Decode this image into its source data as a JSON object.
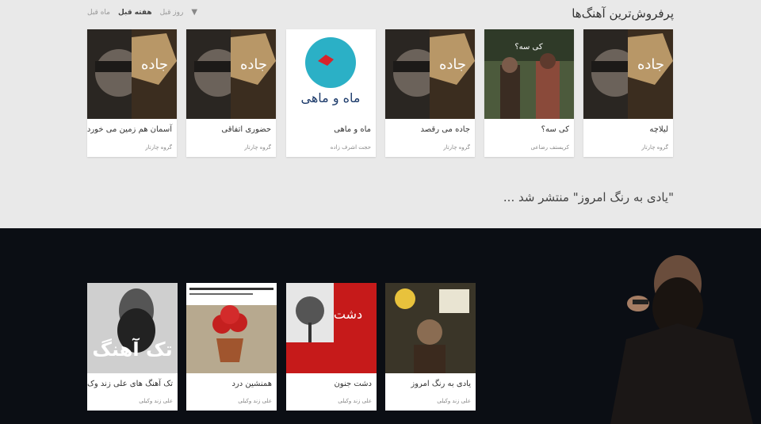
{
  "bestsellers": {
    "title": "پرفروش‌ترین آهنگ‌ها",
    "filters": [
      "روز قبل",
      "هفته قبل",
      "ماه قبل"
    ],
    "active_filter": "هفته قبل",
    "items": [
      {
        "title": "لیلاچه",
        "artist": "گروه چارتار"
      },
      {
        "title": "کی سه؟",
        "artist": "کریستف رضاعی"
      },
      {
        "title": "جاده می رقصد",
        "artist": "گروه چارتار"
      },
      {
        "title": "ماه و ماهی",
        "artist": "حجت اشرف زاده"
      },
      {
        "title": "حضوری اتفاقی",
        "artist": "گروه چارتار"
      },
      {
        "title": "آسمان هم زمین می خورد",
        "artist": "گروه چارتار"
      }
    ]
  },
  "release": {
    "text": "\"یادی به رنگ امروز\" منتشر شد ...",
    "items": [
      {
        "title": "یادی به رنگ امروز",
        "artist": "علی زند وکیلی"
      },
      {
        "title": "دشت جنون",
        "artist": "علی زند وکیلی"
      },
      {
        "title": "همنشین درد",
        "artist": "علی زند وکیلی"
      },
      {
        "title": "تک آهنگ های علی زند وک",
        "artist": "علی زند وکیلی"
      }
    ]
  },
  "colors": {
    "top_bg": "#e9e9e9",
    "bottom_bg": "#0b0e14",
    "accent_red": "#c61a1a"
  }
}
